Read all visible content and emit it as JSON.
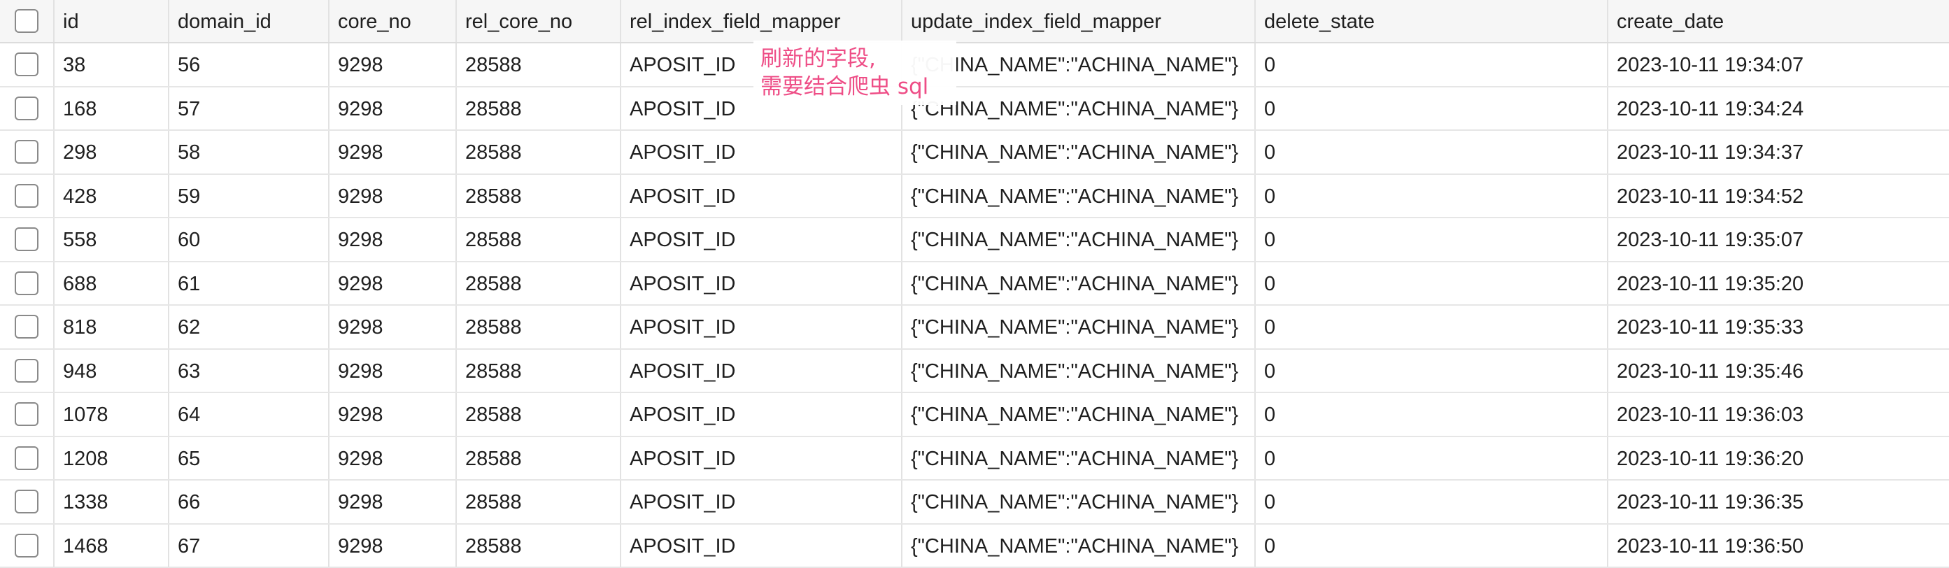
{
  "table": {
    "columns": [
      "id",
      "domain_id",
      "core_no",
      "rel_core_no",
      "rel_index_field_mapper",
      "update_index_field_mapper",
      "delete_state",
      "create_date"
    ],
    "rows": [
      [
        "38",
        "56",
        "9298",
        "28588",
        "APOSIT_ID",
        "{\"CHINA_NAME\":\"ACHINA_NAME\"}",
        "0",
        "2023-10-11 19:34:07"
      ],
      [
        "168",
        "57",
        "9298",
        "28588",
        "APOSIT_ID",
        "{\"CHINA_NAME\":\"ACHINA_NAME\"}",
        "0",
        "2023-10-11 19:34:24"
      ],
      [
        "298",
        "58",
        "9298",
        "28588",
        "APOSIT_ID",
        "{\"CHINA_NAME\":\"ACHINA_NAME\"}",
        "0",
        "2023-10-11 19:34:37"
      ],
      [
        "428",
        "59",
        "9298",
        "28588",
        "APOSIT_ID",
        "{\"CHINA_NAME\":\"ACHINA_NAME\"}",
        "0",
        "2023-10-11 19:34:52"
      ],
      [
        "558",
        "60",
        "9298",
        "28588",
        "APOSIT_ID",
        "{\"CHINA_NAME\":\"ACHINA_NAME\"}",
        "0",
        "2023-10-11 19:35:07"
      ],
      [
        "688",
        "61",
        "9298",
        "28588",
        "APOSIT_ID",
        "{\"CHINA_NAME\":\"ACHINA_NAME\"}",
        "0",
        "2023-10-11 19:35:20"
      ],
      [
        "818",
        "62",
        "9298",
        "28588",
        "APOSIT_ID",
        "{\"CHINA_NAME\":\"ACHINA_NAME\"}",
        "0",
        "2023-10-11 19:35:33"
      ],
      [
        "948",
        "63",
        "9298",
        "28588",
        "APOSIT_ID",
        "{\"CHINA_NAME\":\"ACHINA_NAME\"}",
        "0",
        "2023-10-11 19:35:46"
      ],
      [
        "1078",
        "64",
        "9298",
        "28588",
        "APOSIT_ID",
        "{\"CHINA_NAME\":\"ACHINA_NAME\"}",
        "0",
        "2023-10-11 19:36:03"
      ],
      [
        "1208",
        "65",
        "9298",
        "28588",
        "APOSIT_ID",
        "{\"CHINA_NAME\":\"ACHINA_NAME\"}",
        "0",
        "2023-10-11 19:36:20"
      ],
      [
        "1338",
        "66",
        "9298",
        "28588",
        "APOSIT_ID",
        "{\"CHINA_NAME\":\"ACHINA_NAME\"}",
        "0",
        "2023-10-11 19:36:35"
      ],
      [
        "1468",
        "67",
        "9298",
        "28588",
        "APOSIT_ID",
        "{\"CHINA_NAME\":\"ACHINA_NAME\"}",
        "0",
        "2023-10-11 19:36:50"
      ]
    ]
  },
  "annotation": {
    "line1": "刷新的字段,",
    "line2": "需要结合爬虫 sql",
    "color": "#ee4d86"
  },
  "colors": {
    "header_bg": "#f6f6f6",
    "grid_line": "#e2e2e2"
  }
}
